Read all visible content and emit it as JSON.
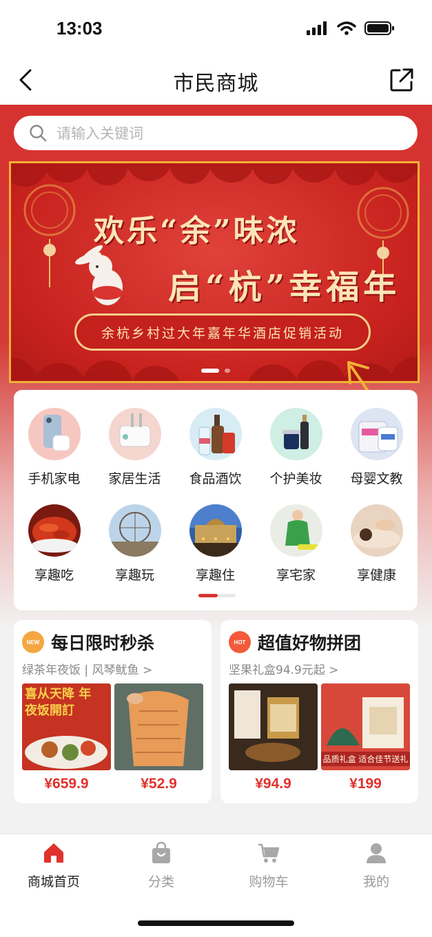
{
  "status_bar": {
    "time": "13:03"
  },
  "nav": {
    "title": "市民商城",
    "back_icon": "chevron-left-icon",
    "share_icon": "external-link-icon"
  },
  "search": {
    "placeholder": "请输入关键词"
  },
  "banner": {
    "title_line1": "欢乐“余”味浓",
    "title_line2": "启“杭”幸福年",
    "subtitle": "余杭乡村过大年嘉年华酒店促销活动",
    "slide_count": 2,
    "active_slide": 1
  },
  "categories": [
    {
      "label": "手机家电",
      "icon": "phone-appliance-image"
    },
    {
      "label": "家居生活",
      "icon": "home-living-image"
    },
    {
      "label": "食品酒饮",
      "icon": "food-drink-image"
    },
    {
      "label": "个护美妆",
      "icon": "personal-care-image"
    },
    {
      "label": "母婴文教",
      "icon": "baby-education-image"
    },
    {
      "label": "享趣吃",
      "icon": "crayfish-image"
    },
    {
      "label": "享趣玩",
      "icon": "ferris-wheel-image"
    },
    {
      "label": "享趣住",
      "icon": "hotel-image"
    },
    {
      "label": "享宅家",
      "icon": "housekeeping-image"
    },
    {
      "label": "享健康",
      "icon": "massage-image"
    }
  ],
  "promos": [
    {
      "badge": "NEW",
      "title": "每日限时秒杀",
      "subtitle": "绿茶年夜饭 | 风琴鱿鱼 >",
      "items": [
        {
          "price": "¥659.9",
          "image_text": "喜从天降 年夜饭開訂"
        },
        {
          "price": "¥52.9"
        }
      ]
    },
    {
      "badge": "HOT",
      "title": "超值好物拼团",
      "subtitle": "坚果礼盒94.9元起 >",
      "items": [
        {
          "price": "¥94.9"
        },
        {
          "price": "¥199",
          "image_text": "品质礼盒 适合佳节送礼"
        }
      ]
    }
  ],
  "tabs": [
    {
      "label": "商城首页",
      "icon": "home-icon",
      "active": true
    },
    {
      "label": "分类",
      "icon": "bag-icon",
      "active": false
    },
    {
      "label": "购物车",
      "icon": "cart-icon",
      "active": false
    },
    {
      "label": "我的",
      "icon": "user-icon",
      "active": false
    }
  ],
  "colors": {
    "accent": "#d6322f",
    "price": "#e0322c",
    "inactive_tab": "#9a9a9a",
    "annotation": "#f2b233"
  }
}
